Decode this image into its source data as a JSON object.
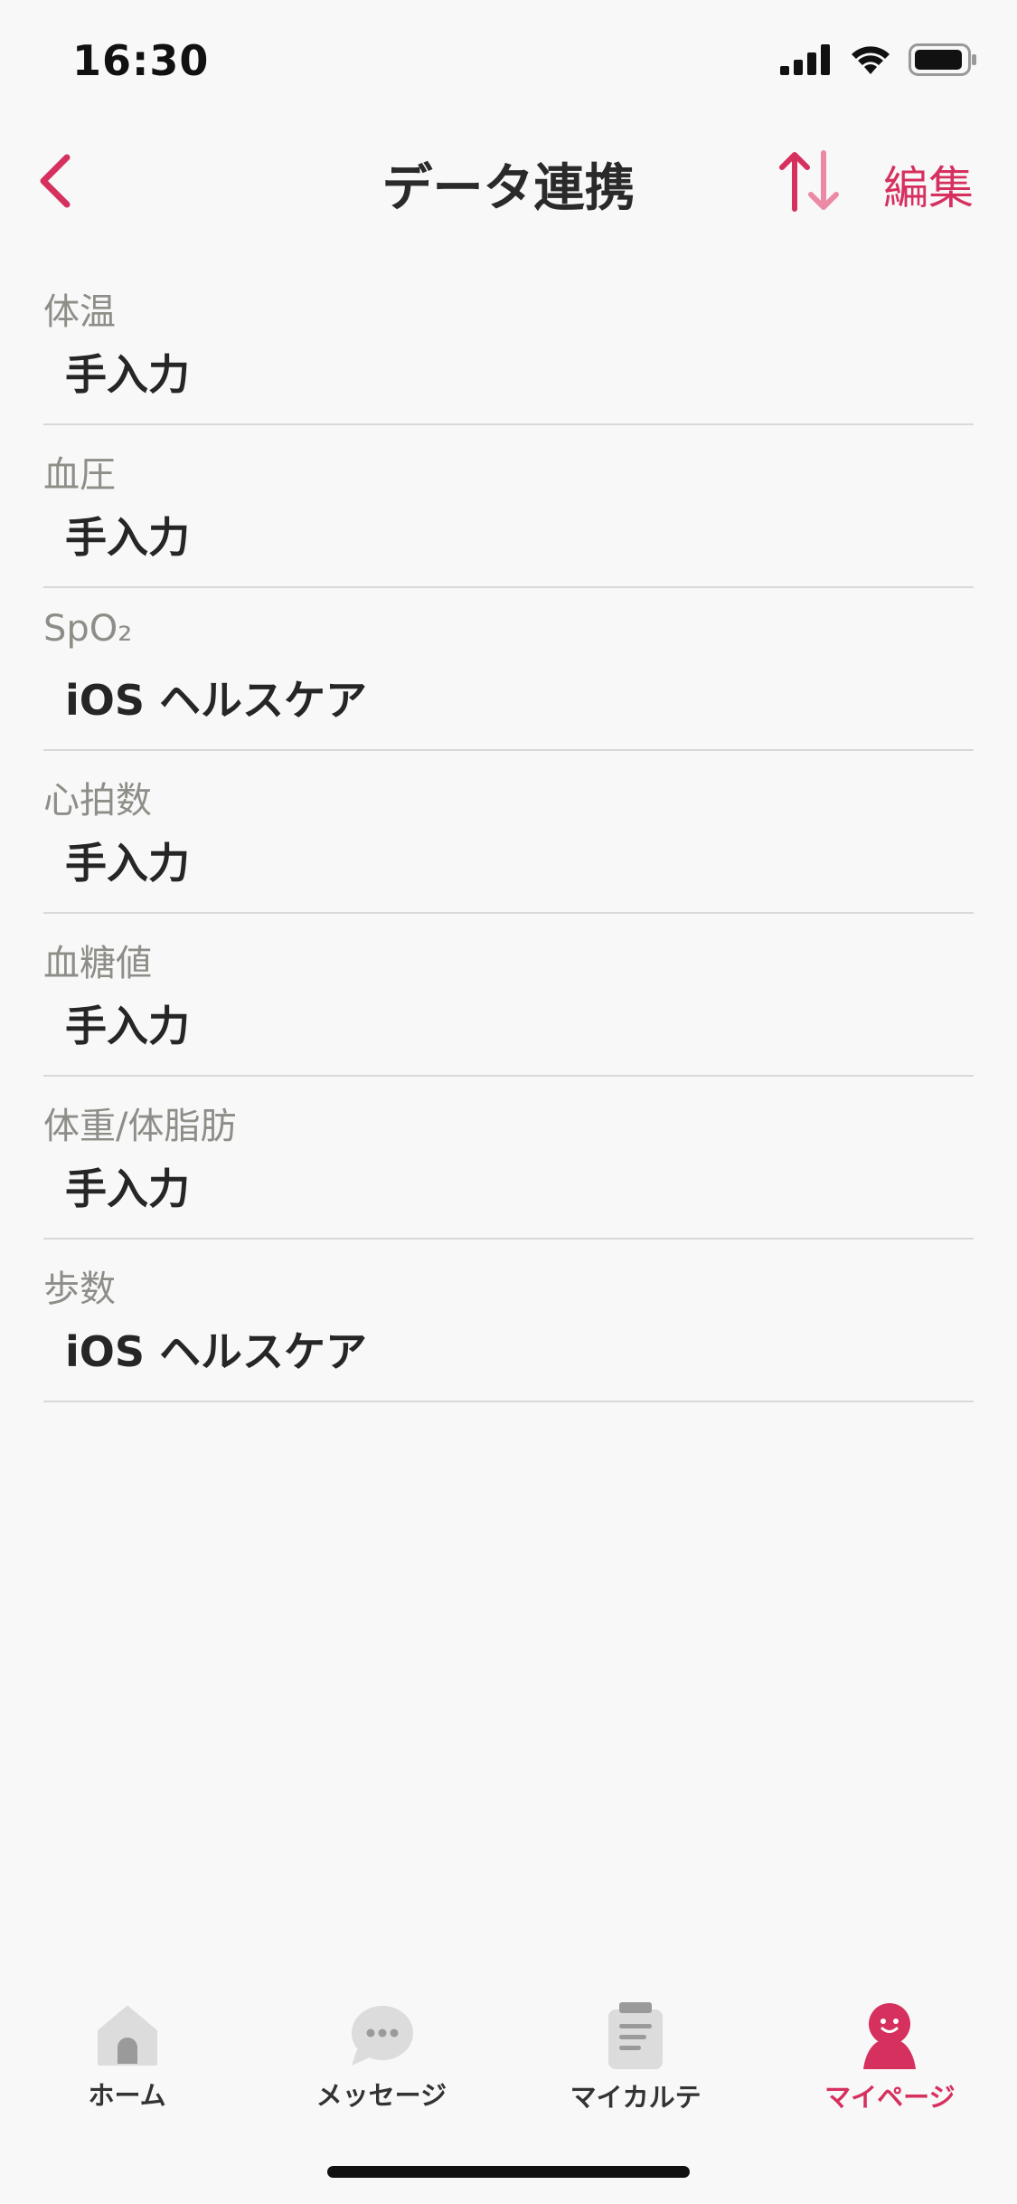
{
  "status_bar": {
    "time": "16:30"
  },
  "nav": {
    "title": "データ連携",
    "edit_label": "編集"
  },
  "items": [
    {
      "label": "体温",
      "value": "手入力"
    },
    {
      "label": "血圧",
      "value": "手入力"
    },
    {
      "label": "SpO₂",
      "value": "iOS ヘルスケア"
    },
    {
      "label": "心拍数",
      "value": "手入力"
    },
    {
      "label": "血糖値",
      "value": "手入力"
    },
    {
      "label": "体重/体脂肪",
      "value": "手入力"
    },
    {
      "label": "歩数",
      "value": "iOS ヘルスケア"
    }
  ],
  "tabs": [
    {
      "label": "ホーム",
      "icon": "home-icon"
    },
    {
      "label": "メッセージ",
      "icon": "message-icon"
    },
    {
      "label": "マイカルテ",
      "icon": "clipboard-icon"
    },
    {
      "label": "マイページ",
      "icon": "person-icon",
      "active": true
    }
  ],
  "colors": {
    "accent": "#d6305f",
    "background": "#f8f8f8",
    "inactive_icon": "#dcdcdc"
  }
}
